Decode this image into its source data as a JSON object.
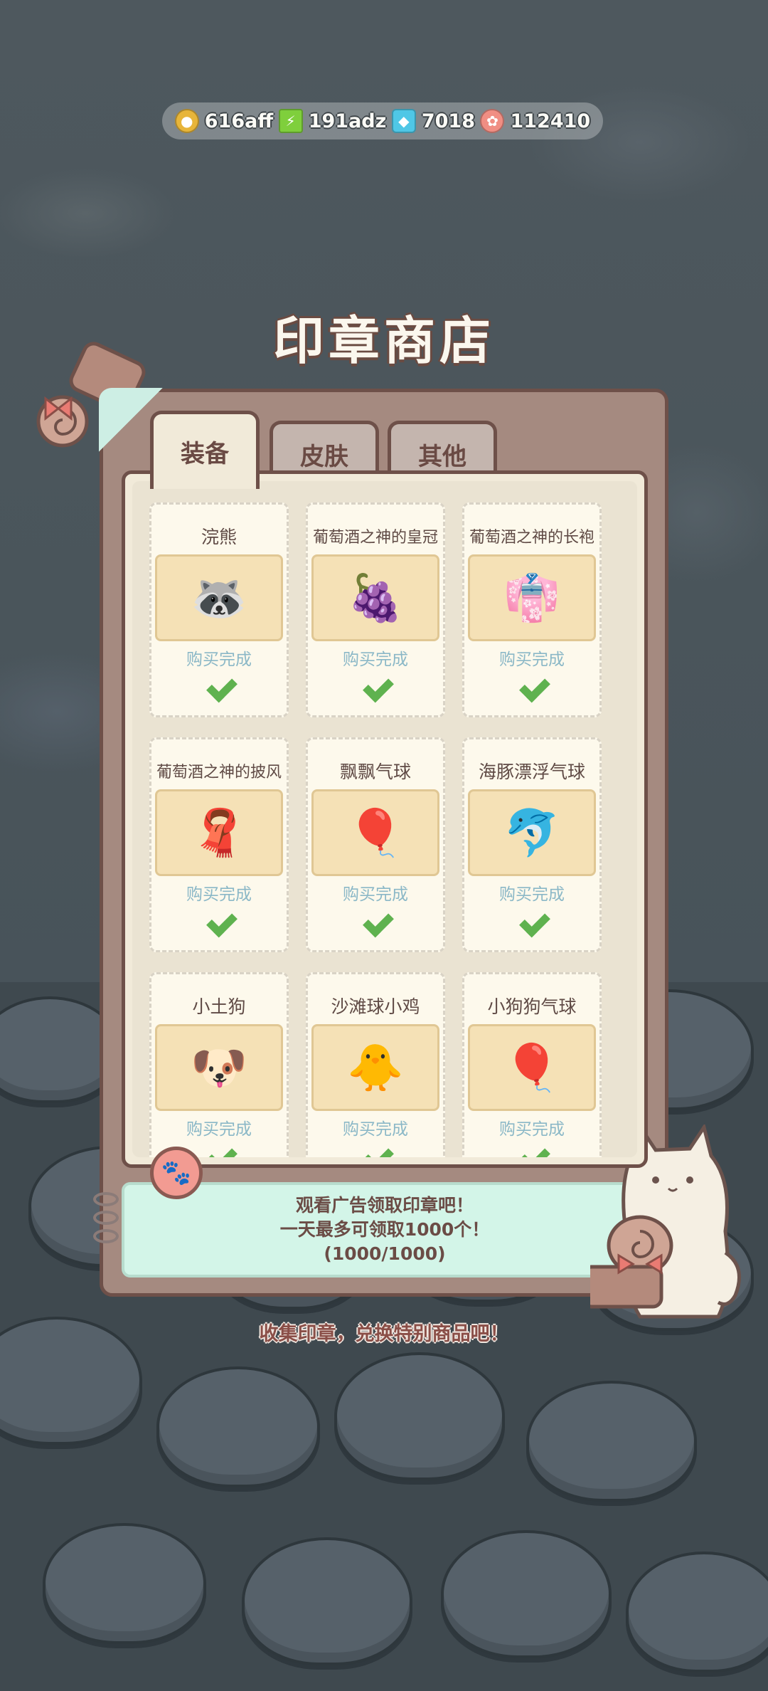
{
  "currencies": [
    {
      "icon": "coin-icon",
      "value": "616aff",
      "color": "#e7b53a"
    },
    {
      "icon": "energy-icon",
      "value": "191adz",
      "color": "#7fcf3c"
    },
    {
      "icon": "gem-icon",
      "value": "7018",
      "color": "#4fc7e6"
    },
    {
      "icon": "stamp-icon",
      "value": "112410",
      "color": "#f08e83"
    }
  ],
  "title": "印章商店",
  "tabs": [
    {
      "label": "装备",
      "active": true
    },
    {
      "label": "皮肤",
      "active": false
    },
    {
      "label": "其他",
      "active": false
    }
  ],
  "items": [
    {
      "name": "浣熊",
      "status": "购买完成",
      "pic": "🦝"
    },
    {
      "name": "葡萄酒之神的皇冠",
      "status": "购买完成",
      "pic": "🍇"
    },
    {
      "name": "葡萄酒之神的长袍",
      "status": "购买完成",
      "pic": "👘"
    },
    {
      "name": "葡萄酒之神的披风",
      "status": "购买完成",
      "pic": "🧣"
    },
    {
      "name": "飘飘气球",
      "status": "购买完成",
      "pic": "🎈"
    },
    {
      "name": "海豚漂浮气球",
      "status": "购买完成",
      "pic": "🐬"
    },
    {
      "name": "小土狗",
      "status": "购买完成",
      "pic": "🐶"
    },
    {
      "name": "沙滩球小鸡",
      "status": "购买完成",
      "pic": "🐥"
    },
    {
      "name": "小狗狗气球",
      "status": "购买完成",
      "pic": "🎈"
    }
  ],
  "ad_panel": {
    "line1": "观看广告领取印章吧！",
    "line2": "一天最多可领取1000个！",
    "line3": "(1000/1000)"
  },
  "footer": "收集印章，兑换特别商品吧！",
  "colors": {
    "board": "#a58a80",
    "border": "#6e5049",
    "status_text": "#8bb8c7",
    "check": "#5fb24f",
    "ad_bg": "#d3f5e8"
  }
}
